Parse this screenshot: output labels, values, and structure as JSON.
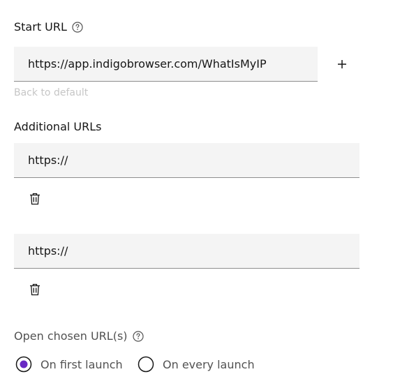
{
  "start_url": {
    "label": "Start URL",
    "value": "https://app.indigobrowser.com/WhatIsMyIP",
    "back_to_default": "Back to default"
  },
  "additional_urls": {
    "label": "Additional URLs",
    "items": [
      {
        "value": "https://"
      },
      {
        "value": "https://"
      }
    ]
  },
  "open_chosen": {
    "label": "Open chosen URL(s)",
    "options": [
      {
        "label": "On first launch",
        "selected": true
      },
      {
        "label": "On every launch",
        "selected": false
      }
    ]
  },
  "colors": {
    "accent": "#6929c4",
    "field_bg": "#f4f4f4",
    "border": "#8d8d8d"
  }
}
